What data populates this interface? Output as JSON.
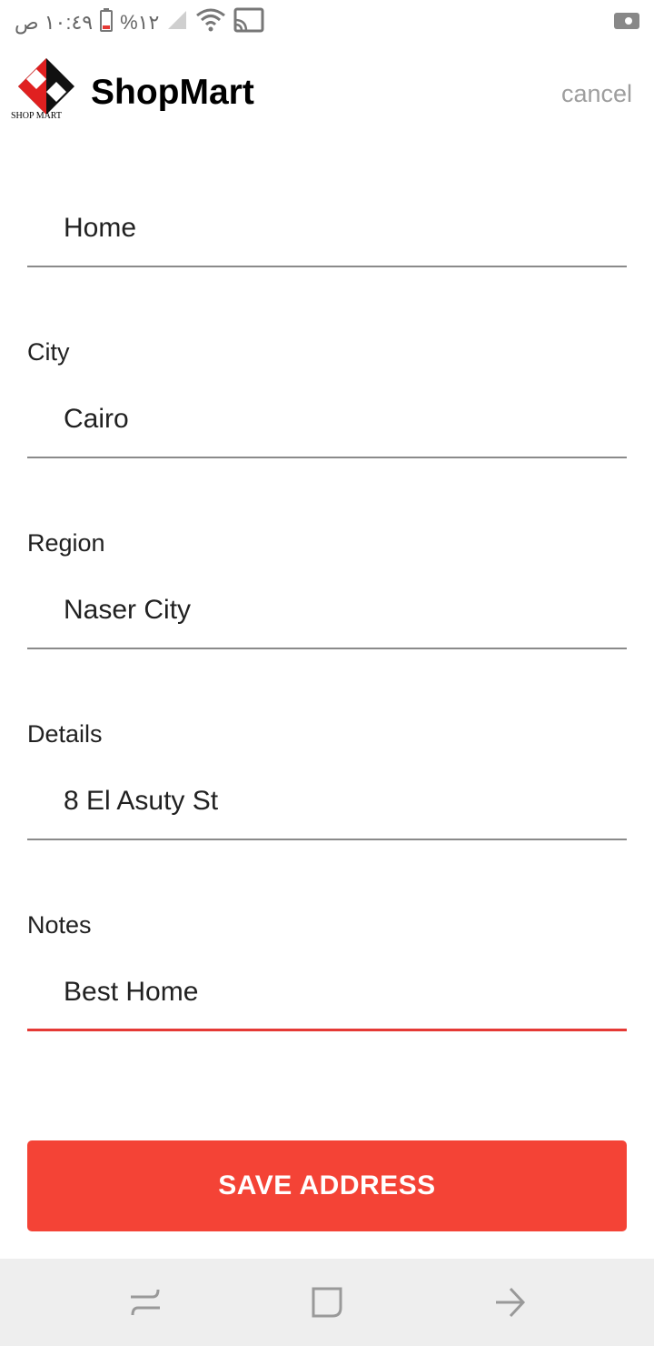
{
  "status_bar": {
    "time": "١٠:٤٩ ص",
    "battery": "%١٢",
    "icons": [
      "battery-icon",
      "signal-icon",
      "wifi-icon",
      "cast-icon",
      "video-record-icon"
    ]
  },
  "header": {
    "logo_caption": "SHOP MART",
    "title": "ShopMart",
    "cancel_label": "cancel"
  },
  "form": {
    "name": {
      "value": "Home"
    },
    "city": {
      "label": "City",
      "value": "Cairo"
    },
    "region": {
      "label": "Region",
      "value": "Naser City"
    },
    "details": {
      "label": "Details",
      "value": "8 El Asuty St"
    },
    "notes": {
      "label": "Notes",
      "value": "Best Home"
    }
  },
  "save_button_label": "SAVE ADDRESS",
  "colors": {
    "accent": "#f44336",
    "active_underline": "#e53935",
    "muted": "#9e9e9e"
  },
  "nav_bar": {
    "icons": [
      "recent-apps-icon",
      "home-icon",
      "back-icon"
    ]
  }
}
